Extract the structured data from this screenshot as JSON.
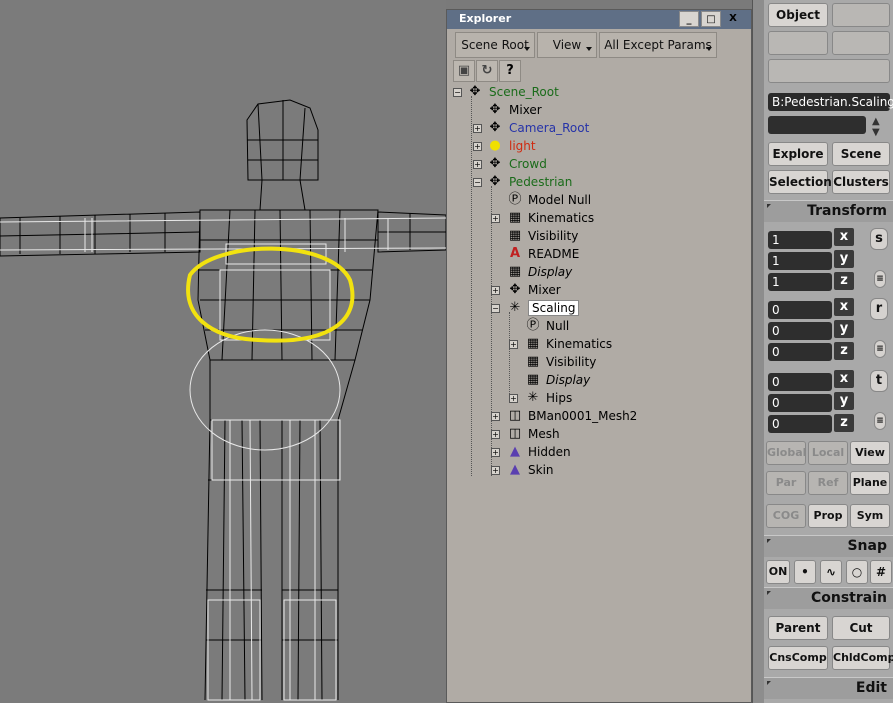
{
  "explorer": {
    "title": "Explorer",
    "window_buttons": [
      "_",
      "□",
      "X"
    ],
    "toolbar": [
      {
        "label": "Scene Root"
      },
      {
        "label": "View"
      },
      {
        "label": "All Except Params"
      }
    ],
    "icons": [
      "lock-icon",
      "refresh-icon",
      "help-icon"
    ],
    "tree": [
      {
        "label": "Scene_Root",
        "color": "#1a6b1a",
        "icon": "figure-icon"
      },
      {
        "label": "Mixer",
        "color": "#000000",
        "icon": "mixer-icon"
      },
      {
        "label": "Camera_Root",
        "color": "#2633a8",
        "icon": "camera-root-icon"
      },
      {
        "label": "light",
        "color": "#d02a10",
        "icon": "light-icon"
      },
      {
        "label": "Crowd",
        "color": "#1a6b1a",
        "icon": "figure-icon"
      },
      {
        "label": "Pedestrian",
        "color": "#1a6b1a",
        "icon": "figure-icon"
      },
      {
        "label": "Model Null",
        "color": "#000000",
        "icon": "null-icon"
      },
      {
        "label": "Kinematics",
        "color": "#000000",
        "icon": "property-icon"
      },
      {
        "label": "Visibility",
        "color": "#000000",
        "icon": "property-icon"
      },
      {
        "label": "README",
        "color": "#000000",
        "icon": "annotation-icon"
      },
      {
        "label": "Display",
        "color": "#000000",
        "icon": "property-icon"
      },
      {
        "label": "Mixer",
        "color": "#000000",
        "icon": "mixer-icon"
      },
      {
        "label": "Scaling",
        "color": "#000000",
        "icon": "bone-icon"
      },
      {
        "label": "Null",
        "color": "#000000",
        "icon": "null-icon"
      },
      {
        "label": "Kinematics",
        "color": "#000000",
        "icon": "property-icon"
      },
      {
        "label": "Visibility",
        "color": "#000000",
        "icon": "property-icon"
      },
      {
        "label": "Display",
        "color": "#000000",
        "icon": "property-icon"
      },
      {
        "label": "Hips",
        "color": "#000000",
        "icon": "bone-icon"
      },
      {
        "label": "BMan0001_Mesh2",
        "color": "#000000",
        "icon": "mesh-icon"
      },
      {
        "label": "Mesh",
        "color": "#000000",
        "icon": "mesh-icon"
      },
      {
        "label": "Hidden",
        "color": "#000000",
        "icon": "group-icon"
      },
      {
        "label": "Skin",
        "color": "#000000",
        "icon": "group-icon"
      }
    ]
  },
  "panel": {
    "object_button": "Object",
    "path_field": "B:Pedestrian.Scaling",
    "explore": "Explore",
    "scene": "Scene",
    "selection": "Selection",
    "clusters": "Clusters",
    "transform_title": "Transform",
    "scale_values": [
      "1",
      "1",
      "1"
    ],
    "rotate_values": [
      "0",
      "0",
      "0"
    ],
    "translate_values": [
      "0",
      "0",
      "0"
    ],
    "axes": [
      "x",
      "y",
      "z"
    ],
    "side_labels": [
      "s",
      "r",
      "t"
    ],
    "global": "Global",
    "local": "Local",
    "view": "View",
    "par": "Par",
    "ref": "Ref",
    "plane": "Plane",
    "cog": "COG",
    "prop": "Prop",
    "sym": "Sym",
    "snap_title": "Snap",
    "snap_on": "ON",
    "constrain_title": "Constrain",
    "parent": "Parent",
    "cut": "Cut",
    "cnscomp": "CnsComp",
    "chldcomp": "ChldComp",
    "edit_title": "Edit"
  }
}
